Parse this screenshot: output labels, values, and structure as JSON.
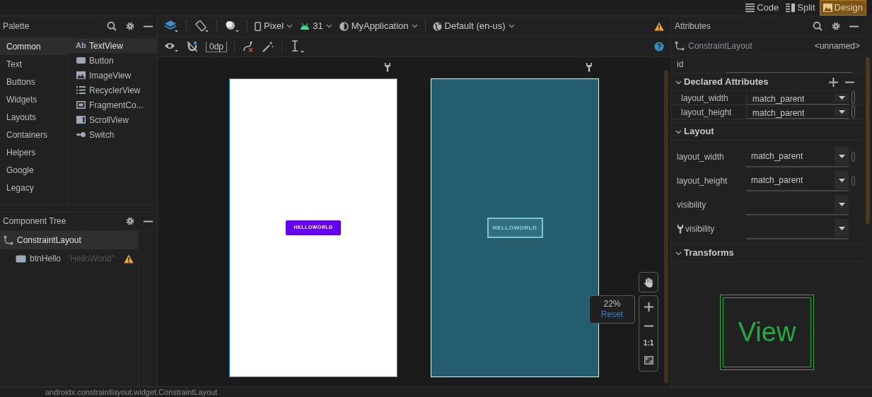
{
  "view_modes": [
    {
      "label": "Code",
      "kind": "code",
      "selected": false
    },
    {
      "label": "Split",
      "kind": "split",
      "selected": false
    },
    {
      "label": "Design",
      "kind": "design",
      "selected": true
    }
  ],
  "palette": {
    "title": "Palette",
    "categories": [
      {
        "label": "Common",
        "selected": true
      },
      {
        "label": "Text",
        "selected": false
      },
      {
        "label": "Buttons",
        "selected": false
      },
      {
        "label": "Widgets",
        "selected": false
      },
      {
        "label": "Layouts",
        "selected": false
      },
      {
        "label": "Containers",
        "selected": false
      },
      {
        "label": "Helpers",
        "selected": false
      },
      {
        "label": "Google",
        "selected": false
      },
      {
        "label": "Legacy",
        "selected": false
      }
    ],
    "items": [
      {
        "label": "TextView",
        "kind": "text",
        "glyph": "Ab",
        "selected": true
      },
      {
        "label": "Button",
        "kind": "button",
        "selected": false
      },
      {
        "label": "ImageView",
        "kind": "image",
        "selected": false
      },
      {
        "label": "RecyclerView",
        "kind": "list",
        "selected": false
      },
      {
        "label": "FragmentCo...",
        "kind": "fragment",
        "selected": false
      },
      {
        "label": "ScrollView",
        "kind": "scroll",
        "selected": false
      },
      {
        "label": "Switch",
        "kind": "switch",
        "selected": false
      }
    ]
  },
  "component_tree": {
    "title": "Component Tree",
    "nodes": [
      {
        "label": "ConstraintLayout",
        "kind": "layout",
        "selected": true,
        "warning": false,
        "children": [
          {
            "label": "btnHello",
            "detail": "\"HelloWorld\"",
            "kind": "button",
            "selected": false,
            "warning": true
          }
        ]
      }
    ]
  },
  "toolbar": {
    "device": "Pixel",
    "api": "31",
    "theme": "MyApplication",
    "locale": "Default (en-us)",
    "margin": "0dp",
    "warning": true
  },
  "design_surface": {
    "button_text": "HELLOWORLD"
  },
  "blueprint": {
    "button_text": "HELLOWORLD"
  },
  "zoom": {
    "percent": "22%",
    "reset": "Reset",
    "one_to_one": "1:1"
  },
  "attributes": {
    "title": "Attributes",
    "component": "ConstraintLayout",
    "component_id": "<unnamed>",
    "id_label": "id",
    "sections": [
      {
        "title": "Declared Attributes",
        "kind": "table",
        "expanded": true,
        "rows": [
          {
            "name": "layout_width",
            "value": "match_parent"
          },
          {
            "name": "layout_height",
            "value": "match_parent"
          }
        ]
      },
      {
        "title": "Layout",
        "kind": "form",
        "expanded": true,
        "rows": [
          {
            "name": "layout_width",
            "value": "match_parent",
            "tools": false
          },
          {
            "name": "layout_height",
            "value": "match_parent",
            "tools": false
          },
          {
            "name": "visibility",
            "tools": false
          },
          {
            "name": "visibility",
            "tools": true
          }
        ]
      },
      {
        "title": "Transforms",
        "kind": "preview",
        "expanded": true,
        "preview": "View"
      }
    ]
  },
  "status_bar": "androidx.constraintlayout.widget.ConstraintLayout"
}
